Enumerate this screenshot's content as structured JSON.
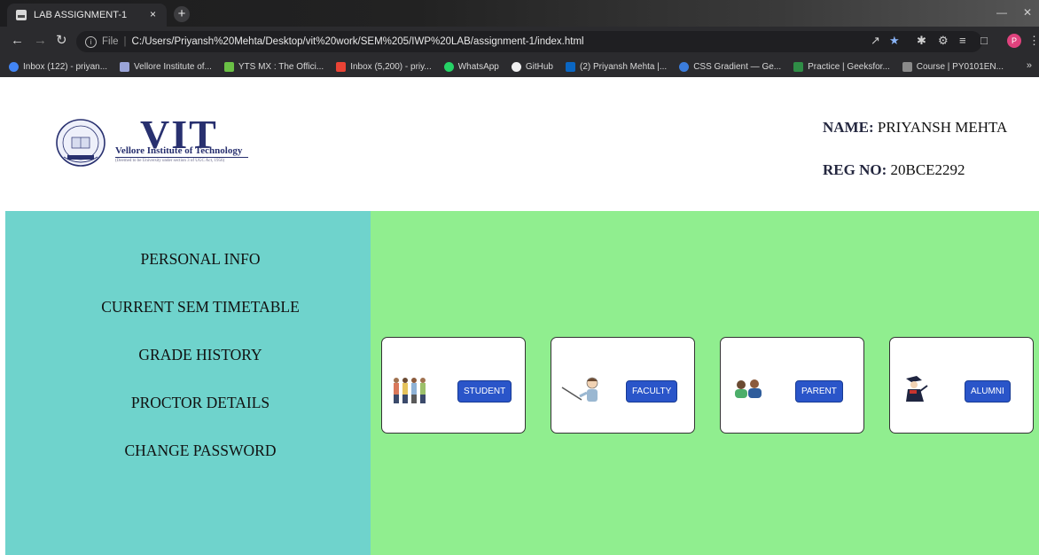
{
  "browser": {
    "tab_title": "LAB ASSIGNMENT-1",
    "tab_close": "×",
    "new_tab": "+",
    "url_scheme": "File",
    "url_separator": "|",
    "url": "C:/Users/Priyansh%20Mehta/Desktop/vit%20work/SEM%205/IWP%20LAB/assignment-1/index.html",
    "profile_initial": "P",
    "bookmarks": [
      {
        "label": "Inbox (122) - priyan...",
        "icon": "google-icon",
        "color": "#4285f4"
      },
      {
        "label": "Vellore Institute of...",
        "icon": "vit-icon",
        "color": "#9aa4d8"
      },
      {
        "label": "YTS MX : The Offici...",
        "icon": "yts-icon",
        "color": "#6ac045"
      },
      {
        "label": "Inbox (5,200) - priy...",
        "icon": "gmail-icon",
        "color": "#ea4335"
      },
      {
        "label": "WhatsApp",
        "icon": "whatsapp-icon",
        "color": "#25d366"
      },
      {
        "label": "GitHub",
        "icon": "github-icon",
        "color": "#f0f0f0"
      },
      {
        "label": "(2) Priyansh Mehta |...",
        "icon": "linkedin-icon",
        "color": "#0a66c2"
      },
      {
        "label": "CSS Gradient — Ge...",
        "icon": "css-gradient-icon",
        "color": "#3b7ddd"
      },
      {
        "label": "Practice | Geeksfor...",
        "icon": "geeksforgeeks-icon",
        "color": "#2f8d46"
      },
      {
        "label": "Course | PY0101EN...",
        "icon": "course-icon",
        "color": "#8a8a8a"
      }
    ],
    "bookmarks_more": "»"
  },
  "header": {
    "logo_title": "VIT",
    "logo_name": "Vellore Institute of Technology",
    "logo_subtitle": "(Deemed to be University under section 3 of UGC Act, 1956)",
    "name_label": "NAME:",
    "name_value": "PRIYANSH MEHTA",
    "reg_label": "REG NO:",
    "reg_value": "20BCE2292"
  },
  "sidebar": {
    "items": [
      {
        "label": "PERSONAL INFO"
      },
      {
        "label": "CURRENT SEM TIMETABLE"
      },
      {
        "label": "GRADE HISTORY"
      },
      {
        "label": "PROCTOR DETAILS"
      },
      {
        "label": "CHANGE PASSWORD"
      }
    ]
  },
  "cards": [
    {
      "label": "STUDENT",
      "icon": "students-icon"
    },
    {
      "label": "FACULTY",
      "icon": "teacher-icon"
    },
    {
      "label": "PARENT",
      "icon": "parents-icon"
    },
    {
      "label": "ALUMNI",
      "icon": "graduate-icon"
    }
  ],
  "colors": {
    "sidebar_bg": "#6fd3cc",
    "main_bg": "#90ee8f",
    "button_bg": "#2a55c9",
    "logo_navy": "#28306f"
  }
}
